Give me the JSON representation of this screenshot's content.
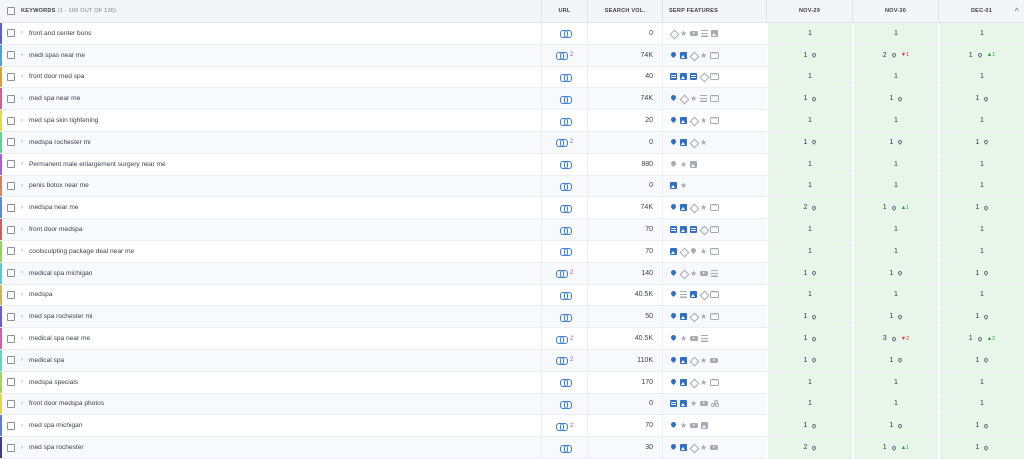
{
  "header": {
    "keywords_label": "KEYWORDS",
    "keywords_count": "(1 - 100 OUT OF 136)",
    "url": "URL",
    "search_vol": "SEARCH VOL.",
    "serp_features": "SERP FEATURES",
    "dates": [
      "NOV-29",
      "NOV-30",
      "DEC-01"
    ],
    "scroll_up_icon": "chevron-up-icon"
  },
  "rows": [
    {
      "keyword": "front and center buns",
      "stripe": "#5b5bd6",
      "url_count": "",
      "volume": "0",
      "serp": [
        "diamond",
        "star",
        "video",
        "list",
        "image-grey"
      ],
      "ranks": [
        {
          "v": "1",
          "pin": false,
          "d": ""
        },
        {
          "v": "1",
          "pin": false,
          "d": ""
        },
        {
          "v": "1",
          "pin": false,
          "d": ""
        }
      ]
    },
    {
      "keyword": "medi spas near me",
      "stripe": "#4fa3d8",
      "url_count": "2",
      "volume": "74K",
      "serp": [
        "pin",
        "image",
        "diamond",
        "star",
        "more"
      ],
      "ranks": [
        {
          "v": "1",
          "pin": true,
          "d": ""
        },
        {
          "v": "2",
          "pin": true,
          "d": "-1"
        },
        {
          "v": "1",
          "pin": true,
          "d": "+1"
        }
      ]
    },
    {
      "keyword": "front door med spa",
      "stripe": "#e0a030",
      "url_count": "",
      "volume": "40",
      "serp": [
        "table",
        "image",
        "table",
        "diamond",
        "more"
      ],
      "ranks": [
        {
          "v": "1",
          "pin": false,
          "d": ""
        },
        {
          "v": "1",
          "pin": false,
          "d": ""
        },
        {
          "v": "1",
          "pin": false,
          "d": ""
        }
      ]
    },
    {
      "keyword": "med spa near me",
      "stripe": "#d65b8f",
      "url_count": "",
      "volume": "74K",
      "serp": [
        "pin",
        "diamond",
        "star",
        "list",
        "more"
      ],
      "ranks": [
        {
          "v": "1",
          "pin": true,
          "d": ""
        },
        {
          "v": "1",
          "pin": true,
          "d": ""
        },
        {
          "v": "1",
          "pin": true,
          "d": ""
        }
      ]
    },
    {
      "keyword": "med spa skin tightening",
      "stripe": "#e7d64a",
      "url_count": "",
      "volume": "20",
      "serp": [
        "pin",
        "image",
        "diamond",
        "star",
        "more"
      ],
      "ranks": [
        {
          "v": "1",
          "pin": false,
          "d": ""
        },
        {
          "v": "1",
          "pin": false,
          "d": ""
        },
        {
          "v": "1",
          "pin": false,
          "d": ""
        }
      ]
    },
    {
      "keyword": "medspa rochester mi",
      "stripe": "#5bd68a",
      "url_count": "2",
      "volume": "0",
      "serp": [
        "pin",
        "image",
        "diamond",
        "star"
      ],
      "ranks": [
        {
          "v": "1",
          "pin": true,
          "d": ""
        },
        {
          "v": "1",
          "pin": true,
          "d": ""
        },
        {
          "v": "1",
          "pin": true,
          "d": ""
        }
      ]
    },
    {
      "keyword": "Permanent male enlargement surgery near me",
      "stripe": "#b05bd6",
      "url_count": "",
      "volume": "880",
      "serp": [
        "pin-grey",
        "star",
        "image-grey"
      ],
      "ranks": [
        {
          "v": "1",
          "pin": false,
          "d": ""
        },
        {
          "v": "1",
          "pin": false,
          "d": ""
        },
        {
          "v": "1",
          "pin": false,
          "d": ""
        }
      ]
    },
    {
      "keyword": "penis botox near me",
      "stripe": "#d6845b",
      "url_count": "",
      "volume": "0",
      "serp": [
        "image",
        "star"
      ],
      "ranks": [
        {
          "v": "1",
          "pin": false,
          "d": ""
        },
        {
          "v": "1",
          "pin": false,
          "d": ""
        },
        {
          "v": "1",
          "pin": false,
          "d": ""
        }
      ]
    },
    {
      "keyword": "medspa near me",
      "stripe": "#5b8fd6",
      "url_count": "",
      "volume": "74K",
      "serp": [
        "pin",
        "image",
        "diamond",
        "star",
        "more"
      ],
      "ranks": [
        {
          "v": "2",
          "pin": true,
          "d": ""
        },
        {
          "v": "1",
          "pin": true,
          "d": "+1"
        },
        {
          "v": "1",
          "pin": true,
          "d": ""
        }
      ]
    },
    {
      "keyword": "front door medspa",
      "stripe": "#d65b5b",
      "url_count": "",
      "volume": "70",
      "serp": [
        "table",
        "image",
        "table",
        "diamond",
        "more"
      ],
      "ranks": [
        {
          "v": "1",
          "pin": false,
          "d": ""
        },
        {
          "v": "1",
          "pin": false,
          "d": ""
        },
        {
          "v": "1",
          "pin": false,
          "d": ""
        }
      ]
    },
    {
      "keyword": "coolsculpting package deal near me",
      "stripe": "#8fd65b",
      "url_count": "",
      "volume": "70",
      "serp": [
        "image",
        "diamond",
        "pin-grey",
        "star",
        "more"
      ],
      "ranks": [
        {
          "v": "1",
          "pin": false,
          "d": ""
        },
        {
          "v": "1",
          "pin": false,
          "d": ""
        },
        {
          "v": "1",
          "pin": false,
          "d": ""
        }
      ]
    },
    {
      "keyword": "medical spa michigan",
      "stripe": "#5bc8d6",
      "url_count": "2",
      "volume": "140",
      "serp": [
        "pin",
        "diamond",
        "star",
        "video",
        "list"
      ],
      "ranks": [
        {
          "v": "1",
          "pin": true,
          "d": ""
        },
        {
          "v": "1",
          "pin": true,
          "d": ""
        },
        {
          "v": "1",
          "pin": true,
          "d": ""
        }
      ]
    },
    {
      "keyword": "medspa",
      "stripe": "#d6b45b",
      "url_count": "",
      "volume": "40.5K",
      "serp": [
        "pin",
        "list",
        "image",
        "diamond",
        "more"
      ],
      "ranks": [
        {
          "v": "1",
          "pin": false,
          "d": ""
        },
        {
          "v": "1",
          "pin": false,
          "d": ""
        },
        {
          "v": "1",
          "pin": false,
          "d": ""
        }
      ]
    },
    {
      "keyword": "med spa rochester mi",
      "stripe": "#6a5bd6",
      "url_count": "",
      "volume": "50",
      "serp": [
        "pin",
        "image",
        "diamond",
        "star",
        "more"
      ],
      "ranks": [
        {
          "v": "1",
          "pin": true,
          "d": ""
        },
        {
          "v": "1",
          "pin": true,
          "d": ""
        },
        {
          "v": "1",
          "pin": true,
          "d": ""
        }
      ]
    },
    {
      "keyword": "medical spa near me",
      "stripe": "#d65bb4",
      "url_count": "2",
      "volume": "40.5K",
      "serp": [
        "pin",
        "star",
        "video",
        "list"
      ],
      "ranks": [
        {
          "v": "1",
          "pin": true,
          "d": ""
        },
        {
          "v": "3",
          "pin": true,
          "d": "-2"
        },
        {
          "v": "1",
          "pin": true,
          "d": "+2"
        }
      ]
    },
    {
      "keyword": "medical spa",
      "stripe": "#5bd6c0",
      "url_count": "2",
      "volume": "110K",
      "serp": [
        "pin",
        "image",
        "diamond",
        "star",
        "video"
      ],
      "ranks": [
        {
          "v": "1",
          "pin": true,
          "d": ""
        },
        {
          "v": "1",
          "pin": true,
          "d": ""
        },
        {
          "v": "1",
          "pin": true,
          "d": ""
        }
      ]
    },
    {
      "keyword": "medspa specials",
      "stripe": "#a0d65b",
      "url_count": "",
      "volume": "170",
      "serp": [
        "pin",
        "image",
        "diamond",
        "star",
        "more"
      ],
      "ranks": [
        {
          "v": "1",
          "pin": false,
          "d": ""
        },
        {
          "v": "1",
          "pin": false,
          "d": ""
        },
        {
          "v": "1",
          "pin": false,
          "d": ""
        }
      ]
    },
    {
      "keyword": "front door medspa photos",
      "stripe": "#e7d64a",
      "url_count": "",
      "volume": "0",
      "serp": [
        "table",
        "image",
        "star",
        "video",
        "tree"
      ],
      "ranks": [
        {
          "v": "1",
          "pin": false,
          "d": ""
        },
        {
          "v": "1",
          "pin": false,
          "d": ""
        },
        {
          "v": "1",
          "pin": false,
          "d": ""
        }
      ]
    },
    {
      "keyword": "med spa michigan",
      "stripe": "#5b7bd6",
      "url_count": "2",
      "volume": "70",
      "serp": [
        "pin",
        "star",
        "video",
        "image-grey"
      ],
      "ranks": [
        {
          "v": "1",
          "pin": true,
          "d": ""
        },
        {
          "v": "1",
          "pin": true,
          "d": ""
        },
        {
          "v": "1",
          "pin": true,
          "d": ""
        }
      ]
    },
    {
      "keyword": "med spa rochester",
      "stripe": "#3b3b8f",
      "url_count": "",
      "volume": "30",
      "serp": [
        "pin",
        "image",
        "diamond",
        "star",
        "video"
      ],
      "ranks": [
        {
          "v": "2",
          "pin": true,
          "d": ""
        },
        {
          "v": "1",
          "pin": true,
          "d": "+1"
        },
        {
          "v": "1",
          "pin": true,
          "d": ""
        }
      ]
    }
  ]
}
